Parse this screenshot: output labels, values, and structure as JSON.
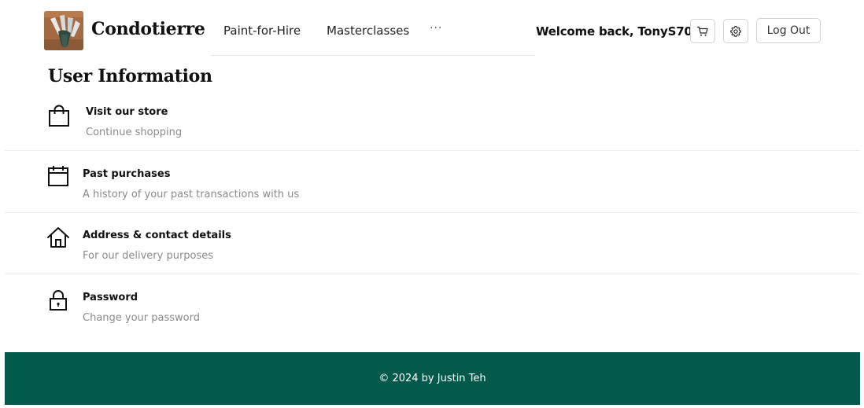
{
  "header": {
    "brand": "Condotierre",
    "nav": [
      {
        "label": "Paint-for-Hire"
      },
      {
        "label": "Masterclasses"
      },
      {
        "label": "···"
      }
    ],
    "welcome": "Welcome back, TonyS70",
    "cart_icon": "cart-icon",
    "settings_icon": "gear-icon",
    "logout_label": "Log Out"
  },
  "main": {
    "title": "User Information",
    "items": [
      {
        "icon": "shopping-bag-icon",
        "title": "Visit our store",
        "subtitle": "Continue shopping"
      },
      {
        "icon": "calendar-icon",
        "title": "Past purchases",
        "subtitle": "A history of your past transactions with us"
      },
      {
        "icon": "house-icon",
        "title": "Address & contact details",
        "subtitle": "For our delivery purposes"
      },
      {
        "icon": "lock-icon",
        "title": "Password",
        "subtitle": "Change your password"
      }
    ]
  },
  "footer": {
    "text": "© 2024 by Justin Teh"
  },
  "colors": {
    "footer_bg": "#03594a",
    "subtitle": "#8a8a8a"
  }
}
